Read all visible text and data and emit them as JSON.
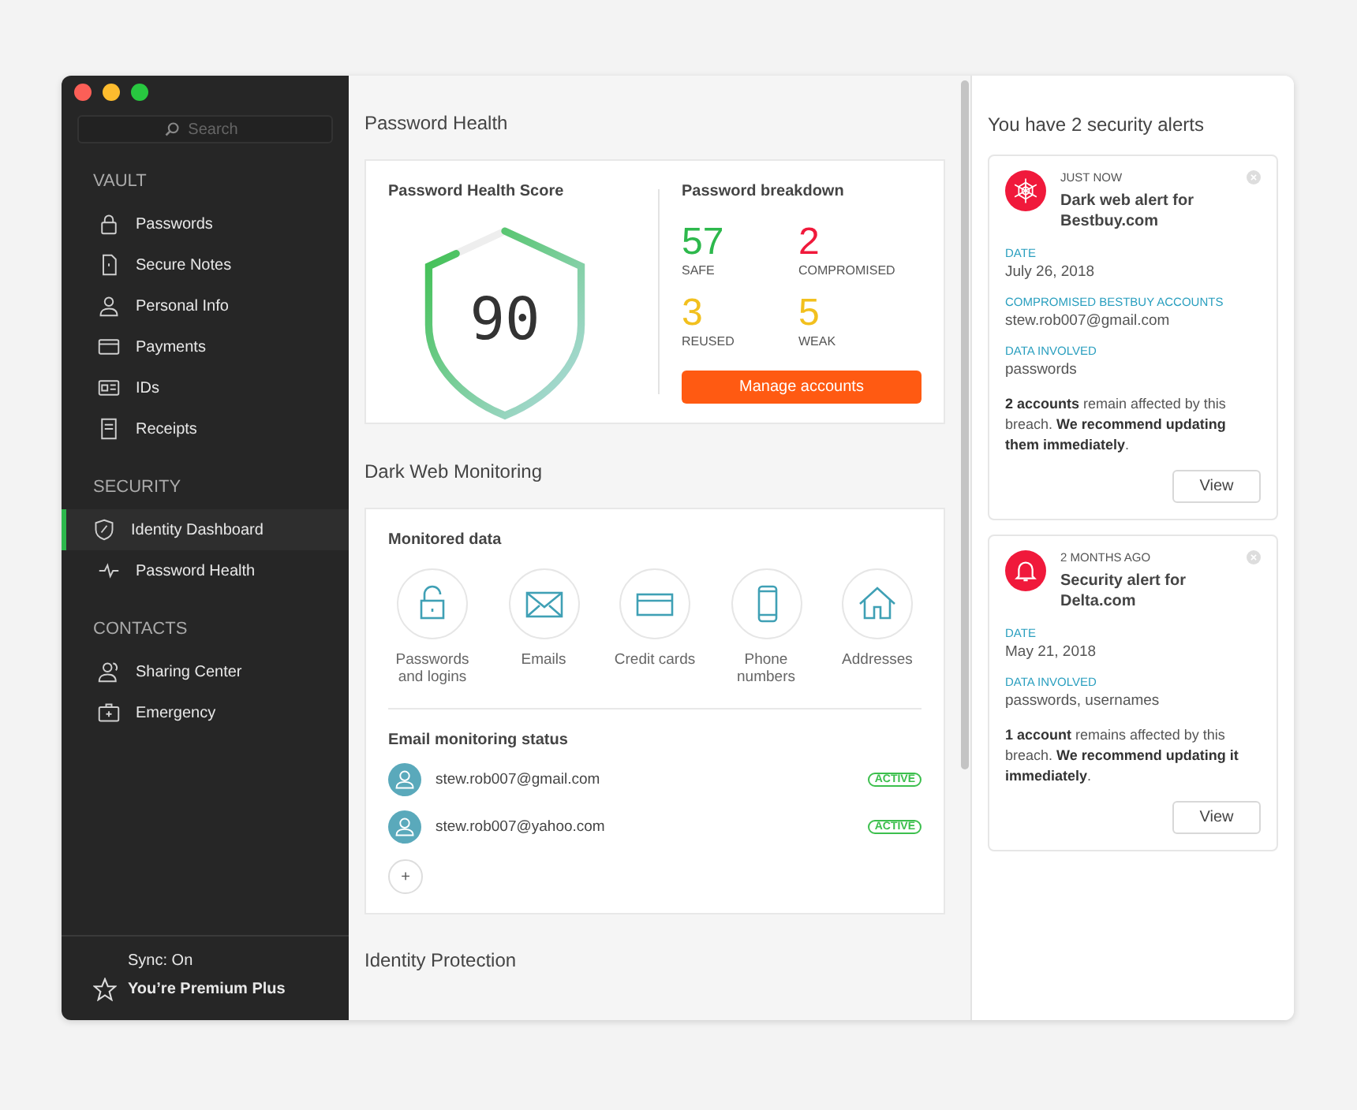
{
  "sidebar": {
    "search": {
      "placeholder": "Search"
    },
    "sections": [
      {
        "title": "VAULT",
        "items": [
          {
            "label": "Passwords",
            "kind": "lock",
            "selected": false
          },
          {
            "label": "Secure Notes",
            "kind": "note",
            "selected": false
          },
          {
            "label": "Personal Info",
            "kind": "person",
            "selected": false
          },
          {
            "label": "Payments",
            "kind": "card",
            "selected": false
          },
          {
            "label": "IDs",
            "kind": "id",
            "selected": false
          },
          {
            "label": "Receipts",
            "kind": "receipt",
            "selected": false
          }
        ]
      },
      {
        "title": "SECURITY",
        "items": [
          {
            "label": "Identity Dashboard",
            "kind": "shield",
            "selected": true
          },
          {
            "label": "Password Health",
            "kind": "pulse",
            "selected": false
          }
        ]
      },
      {
        "title": "CONTACTS",
        "items": [
          {
            "label": "Sharing Center",
            "kind": "people",
            "selected": false
          },
          {
            "label": "Emergency",
            "kind": "kit",
            "selected": false
          }
        ]
      }
    ],
    "sync": "Sync: On",
    "plan": "You’re Premium Plus"
  },
  "password_health": {
    "title": "Password Health",
    "score_title": "Password Health Score",
    "score": "90",
    "level": 0.9,
    "breakdown_title": "Password breakdown",
    "stats": [
      {
        "value": "57",
        "label": "SAFE",
        "color": "#2db84c"
      },
      {
        "value": "2",
        "label": "COMPROMISED",
        "color": "#f0193b"
      },
      {
        "value": "3",
        "label": "REUSED",
        "color": "#f2c01e"
      },
      {
        "value": "5",
        "label": "WEAK",
        "color": "#f2c01e"
      }
    ],
    "button": "Manage accounts"
  },
  "dark_web": {
    "title": "Dark Web Monitoring",
    "monitored_title": "Monitored data",
    "items": [
      {
        "label": "Passwords and logins",
        "kind": "lock"
      },
      {
        "label": "Emails",
        "kind": "mail"
      },
      {
        "label": "Credit cards",
        "kind": "card"
      },
      {
        "label": "Phone numbers",
        "kind": "phone"
      },
      {
        "label": "Addresses",
        "kind": "house"
      }
    ],
    "email_title": "Email monitoring status",
    "emails": [
      {
        "address": "stew.rob007@gmail.com",
        "status": "ACTIVE"
      },
      {
        "address": "stew.rob007@yahoo.com",
        "status": "ACTIVE"
      }
    ],
    "add": "+"
  },
  "next_section": "Identity Protection",
  "alerts": {
    "title": "You have 2 security alerts",
    "list": [
      {
        "kind": "web",
        "time": "JUST NOW",
        "title": "Dark web alert for Bestbuy.com",
        "fields": [
          {
            "label": "DATE",
            "value": "July 26, 2018"
          },
          {
            "label": "COMPROMISED BESTBUY ACCOUNTS",
            "value": "stew.rob007@gmail.com"
          },
          {
            "label": "DATA INVOLVED",
            "value": "passwords"
          }
        ],
        "message": "**2 accounts** remain affected by this breach. **We recommend updating them immediately**.",
        "button": "View"
      },
      {
        "kind": "bell",
        "time": "2 MONTHS AGO",
        "title": "Security alert for Delta.com",
        "fields": [
          {
            "label": "DATE",
            "value": "May 21, 2018"
          },
          {
            "label": "DATA INVOLVED",
            "value": "passwords, usernames"
          }
        ],
        "message": "**1 account** remains affected by this breach. **We recommend updating it immediately**.",
        "button": "View"
      }
    ]
  }
}
